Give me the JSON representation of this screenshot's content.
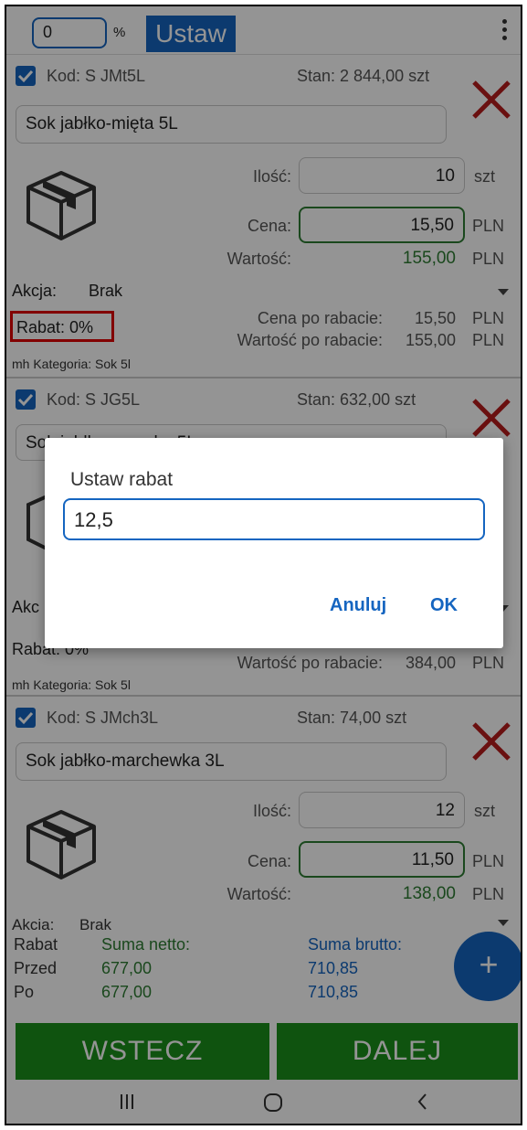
{
  "topbar": {
    "percent_value": "0",
    "percent_sign": "%",
    "set_label": "Ustaw"
  },
  "items": [
    {
      "code": "Kod: S JMt5L",
      "stock": "Stan: 2 844,00 szt",
      "name": "Sok jabłko-mięta 5L",
      "qty_label": "Ilość:",
      "qty": "10",
      "qty_unit": "szt",
      "price_label": "Cena:",
      "price": "15,50",
      "price_unit": "PLN",
      "value_label": "Wartość:",
      "value": "155,00",
      "value_unit": "PLN",
      "action_label": "Akcja:",
      "action_value": "Brak",
      "discount": "Rabat: 0%",
      "disc_price_label": "Cena po rabacie:",
      "disc_price": "15,50",
      "disc_price_unit": "PLN",
      "disc_value_label": "Wartość po rabacie:",
      "disc_value": "155,00",
      "disc_value_unit": "PLN",
      "category": "mh Kategoria: Sok 5l"
    },
    {
      "code": "Kod: S JG5L",
      "stock": "Stan: 632,00 szt",
      "name": "Sok jabłko-gruszka 5L",
      "action_label": "Akc",
      "discount": "Rabat: 0%",
      "disc_value_label": "Wartość po rabacie:",
      "disc_value": "384,00",
      "disc_value_unit": "PLN",
      "category": "mh Kategoria: Sok 5l"
    },
    {
      "code": "Kod: S JMch3L",
      "stock": "Stan: 74,00 szt",
      "name": "Sok jabłko-marchewka 3L",
      "qty_label": "Ilość:",
      "qty": "12",
      "qty_unit": "szt",
      "price_label": "Cena:",
      "price": "11,50",
      "price_unit": "PLN",
      "value_label": "Wartość:",
      "value": "138,00",
      "value_unit": "PLN",
      "action_label": "Akcja:",
      "action_value": "Brak"
    }
  ],
  "summary": {
    "discount_label": "Rabat",
    "before_label": "Przed",
    "after_label": "Po",
    "net_label": "Suma netto:",
    "gross_label": "Suma brutto:",
    "net_before": "677,00",
    "net_after": "677,00",
    "gross_before": "710,85",
    "gross_after": "710,85"
  },
  "buttons": {
    "back": "WSTECZ",
    "next": "DALEJ"
  },
  "dialog": {
    "title": "Ustaw rabat",
    "input_value": "12,5",
    "cancel": "Anuluj",
    "ok": "OK"
  },
  "colors": {
    "accent": "#1565c0",
    "green": "#2e7d32",
    "button_green": "#1b8f1b",
    "delete_red": "#b71c1c"
  }
}
